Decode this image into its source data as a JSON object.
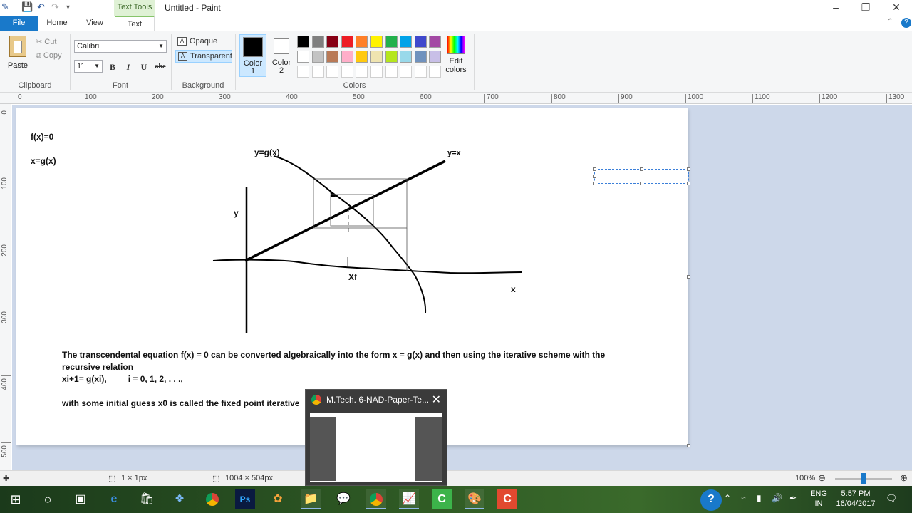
{
  "window": {
    "title": "Untitled - Paint",
    "context_tab": "Text Tools"
  },
  "tabs": [
    {
      "label": "File"
    },
    {
      "label": "Home"
    },
    {
      "label": "View"
    },
    {
      "label": "Text"
    }
  ],
  "ribbon": {
    "clipboard": {
      "paste": "Paste",
      "cut": "Cut",
      "copy": "Copy",
      "label": "Clipboard"
    },
    "font": {
      "family": "Calibri",
      "size": "11",
      "bold": "B",
      "italic": "I",
      "underline": "U",
      "strike": "abc",
      "label": "Font"
    },
    "background": {
      "opaque": "Opaque",
      "transparent": "Transparent",
      "label": "Background"
    },
    "colors": {
      "color1_label": "Color",
      "color1_num": "1",
      "color2_label": "Color",
      "color2_num": "2",
      "edit_label": "Edit",
      "edit_label2": "colors",
      "label": "Colors",
      "color1": "#000000",
      "color2": "#ffffff",
      "row1": [
        "#000000",
        "#7f7f7f",
        "#880015",
        "#ed1c24",
        "#ff7f27",
        "#fff200",
        "#22b14c",
        "#00a2e8",
        "#3f48cc",
        "#a349a4"
      ],
      "row2": [
        "#ffffff",
        "#c3c3c3",
        "#b97a57",
        "#ffaec9",
        "#ffc90e",
        "#efe4b0",
        "#b5e61d",
        "#99d9ea",
        "#7092be",
        "#c8bfe7"
      ]
    }
  },
  "ruler": {
    "h": [
      "0",
      "100",
      "200",
      "300",
      "400",
      "500",
      "600",
      "700",
      "800",
      "900",
      "1000",
      "1100",
      "1200",
      "1300"
    ],
    "v": [
      "0",
      "100",
      "200",
      "300",
      "400",
      "500"
    ]
  },
  "canvas_text": {
    "fx": "f(x)=0",
    "gx": "x=g(x)",
    "ygx": "y=g(x)",
    "yx": "y=x",
    "y": "y",
    "xf": "Xf",
    "x": "x",
    "para1": "The transcendental equation f(x) = 0 can be converted algebraically into the form x = g(x) and then using the iterative scheme with the",
    "para2": "recursive relation",
    "para3": "xi+1= g(xi),         i = 0, 1, 2, . . .,",
    "para4": "with some initial guess x0  is called the fixed point iterative"
  },
  "statusbar": {
    "selection": "1 × 1px",
    "size": "1004 × 504px",
    "zoom": "100%"
  },
  "thumbnail": {
    "title": "M.Tech. 6-NAD-Paper-Te..."
  },
  "tray": {
    "lang1": "ENG",
    "lang2": "IN",
    "time": "5:57 PM",
    "date": "16/04/2017"
  }
}
